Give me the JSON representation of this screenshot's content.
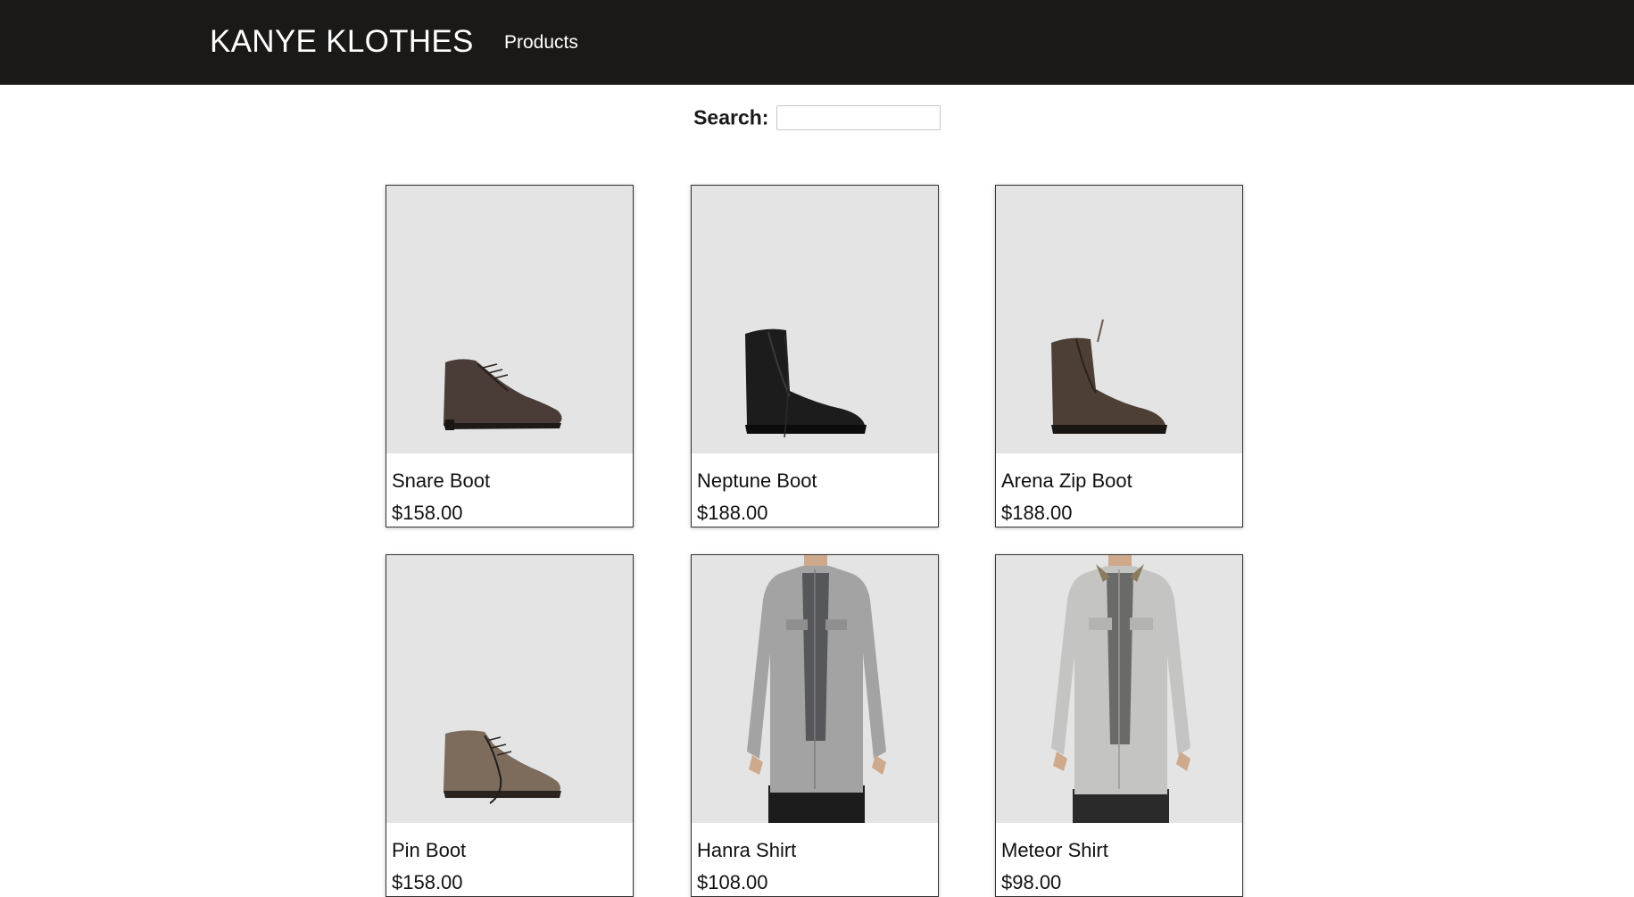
{
  "header": {
    "brand": "KANYE KLOTHES",
    "nav": [
      {
        "label": "Products"
      }
    ]
  },
  "search": {
    "label": "Search:",
    "value": "",
    "placeholder": ""
  },
  "products": [
    {
      "name": "Snare Boot",
      "price": "$158.00",
      "image": "boot-icon",
      "color": "#4a3c36"
    },
    {
      "name": "Neptune Boot",
      "price": "$188.00",
      "image": "boot-icon",
      "color": "#1c1c1c"
    },
    {
      "name": "Arena Zip Boot",
      "price": "$188.00",
      "image": "boot-icon",
      "color": "#4d3f36"
    },
    {
      "name": "Pin Boot",
      "price": "$158.00",
      "image": "boot-icon",
      "color": "#7d6b5c"
    },
    {
      "name": "Hanra Shirt",
      "price": "$108.00",
      "image": "shirt-icon",
      "color": "#a3a3a3"
    },
    {
      "name": "Meteor Shirt",
      "price": "$98.00",
      "image": "shirt-icon",
      "color": "#c4c5c2"
    }
  ]
}
